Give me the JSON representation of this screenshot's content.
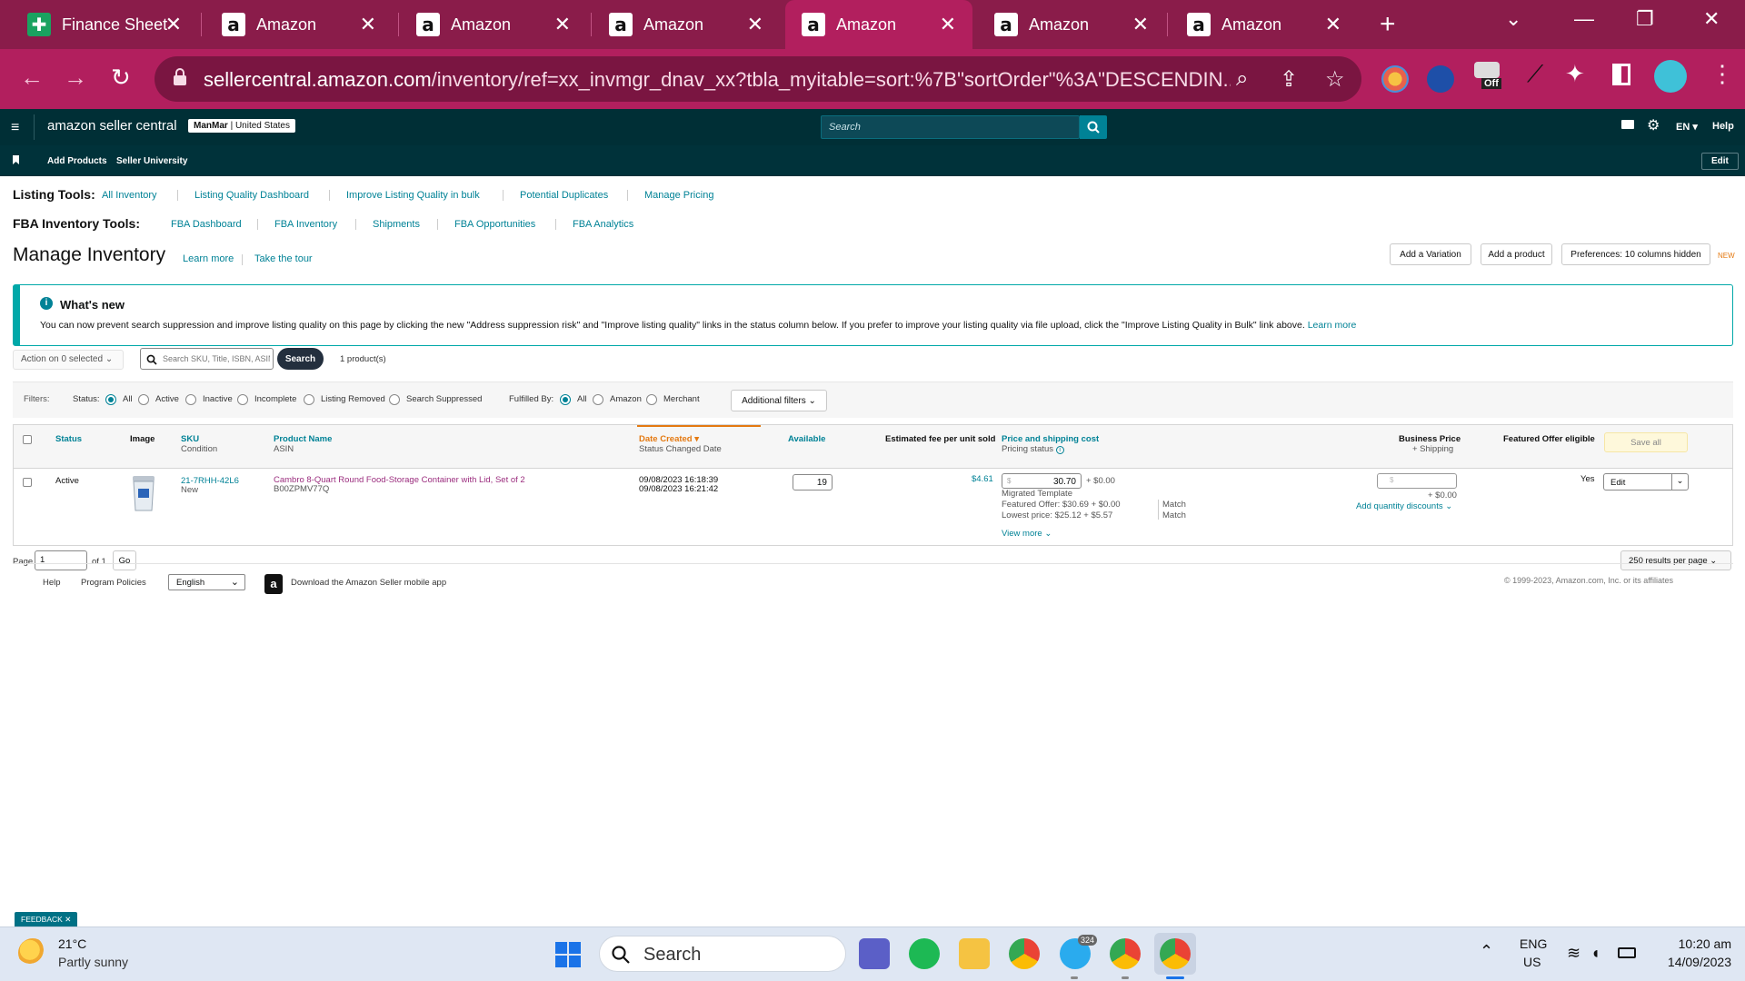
{
  "browser": {
    "tabs": [
      {
        "title": "Finance Sheet",
        "icon": "sheets-icon",
        "active": false
      },
      {
        "title": "Amazon",
        "icon": "amazon-icon",
        "active": false
      },
      {
        "title": "Amazon",
        "icon": "amazon-icon",
        "active": false
      },
      {
        "title": "Amazon",
        "icon": "amazon-icon",
        "active": false
      },
      {
        "title": "Amazon",
        "icon": "amazon-icon",
        "active": true
      },
      {
        "title": "Amazon",
        "icon": "amazon-icon",
        "active": false
      },
      {
        "title": "Amazon",
        "icon": "amazon-icon",
        "active": false
      }
    ],
    "url_host": "sellercentral.amazon.com",
    "url_path": "/inventory/ref=xx_invmgr_dnav_xx?tbla_myitable=sort:%7B\"sortOrder\"%3A\"DESCENDIN...",
    "extension_badge": "Off",
    "accent": "#b21f5e"
  },
  "sc_header": {
    "logo_text": "amazon seller central",
    "store_name": "ManMar",
    "marketplace": "United States",
    "search_placeholder": "Search",
    "language": "EN",
    "help": "Help"
  },
  "sc_subnav": {
    "items": [
      "Add Products",
      "Seller University"
    ],
    "edit": "Edit"
  },
  "listing_tools": {
    "label": "Listing Tools:",
    "links": [
      "All Inventory",
      "Listing Quality Dashboard",
      "Improve Listing Quality in bulk",
      "Potential Duplicates",
      "Manage Pricing"
    ]
  },
  "fba_tools": {
    "label": "FBA Inventory Tools:",
    "links": [
      "FBA Dashboard",
      "FBA Inventory",
      "Shipments",
      "FBA Opportunities",
      "FBA Analytics"
    ]
  },
  "page": {
    "title": "Manage Inventory",
    "learn_more": "Learn more",
    "tour": "Take the tour",
    "add_variation": "Add a Variation",
    "add_product": "Add a product",
    "preferences": "Preferences: 10 columns hidden",
    "new_badge": "NEW"
  },
  "whats_new": {
    "title": "What's new",
    "text": "You can now prevent search suppression and improve listing quality on this page by clicking the new \"Address suppression risk\" and \"Improve listing quality\" links in the status column below. If you prefer to improve your listing quality via file upload, click the \"Improve Listing Quality in Bulk\" link above.",
    "link": "Learn more"
  },
  "actions": {
    "action_dropdown": "Action on 0 selected",
    "search_placeholder": "Search SKU, Title, ISBN, ASIN",
    "search_button": "Search",
    "count": "1 product(s)"
  },
  "filters": {
    "label": "Filters:",
    "status_label": "Status:",
    "status_options": [
      "All",
      "Active",
      "Inactive",
      "Incomplete",
      "Listing Removed",
      "Search Suppressed"
    ],
    "fulfilled_label": "Fulfilled By:",
    "fulfilled_options": [
      "All",
      "Amazon",
      "Merchant"
    ],
    "additional": "Additional filters"
  },
  "table": {
    "headers": {
      "status": "Status",
      "image": "Image",
      "sku": "SKU",
      "condition": "Condition",
      "product_name": "Product Name",
      "asin": "ASIN",
      "date_created": "Date Created",
      "status_changed": "Status Changed Date",
      "available": "Available",
      "fee": "Estimated fee per unit sold",
      "price": "Price and shipping cost",
      "pricing_status": "Pricing status",
      "business_price": "Business Price",
      "shipping": "+ Shipping",
      "featured": "Featured Offer eligible",
      "save_all": "Save all"
    },
    "row": {
      "status": "Active",
      "sku": "21-7RHH-42L6",
      "condition": "New",
      "product_name": "Cambro 8-Quart Round Food-Storage Container with Lid, Set of 2",
      "asin": "B00ZPMV77Q",
      "date_created": "09/08/2023 16:18:39",
      "status_changed": "09/08/2023 16:21:42",
      "available": "19",
      "fee": "$4.61",
      "price_currency": "$",
      "price": "30.70",
      "shipping": "+ $0.00",
      "template": "Migrated Template",
      "featured_offer": "Featured Offer: $30.69 + $0.00",
      "lowest_price": "Lowest price: $25.12 + $5.57",
      "match1": "Match",
      "match2": "Match",
      "view_more": "View more",
      "business_currency": "$",
      "business_shipping": "+ $0.00",
      "quantity_discounts": "Add quantity discounts",
      "featured": "Yes",
      "edit": "Edit"
    }
  },
  "pagination": {
    "page_label": "Page",
    "page_value": "1",
    "of": "of 1",
    "go": "Go",
    "per_page": "250 results per page"
  },
  "footer": {
    "help": "Help",
    "policies": "Program Policies",
    "language": "English",
    "app": "Download the Amazon Seller mobile app",
    "copyright": "© 1999-2023, Amazon.com, Inc. or its affiliates",
    "feedback": "FEEDBACK"
  },
  "taskbar": {
    "temp": "21°C",
    "weather": "Partly sunny",
    "search": "Search",
    "telegram_badge": "324",
    "lang1": "ENG",
    "lang2": "US",
    "time": "10:20 am",
    "date": "14/09/2023"
  }
}
